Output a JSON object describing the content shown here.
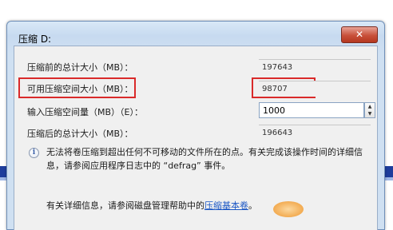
{
  "dialog": {
    "title": "压缩 D:",
    "close_label": "✕"
  },
  "fields": {
    "total_before": {
      "label": "压缩前的总计大小（MB）：",
      "value": "197643"
    },
    "available": {
      "label": "可用压缩空间大小（MB）：",
      "value": "98707"
    },
    "shrink_amount": {
      "label": "输入压缩空间量（MB）（E）：",
      "value": "1000"
    },
    "total_after": {
      "label": "压缩后的总计大小（MB）：",
      "value": "196643"
    }
  },
  "info": {
    "icon": "info-icon",
    "text": "无法将卷压缩到超出任何不可移动的文件所在的点。有关完成该操作时间的详细信息，请参阅应用程序日志中的 “defrag” 事件。"
  },
  "help": {
    "prefix": "有关详细信息，请参阅磁盘管理帮助中的",
    "link": "压缩基本卷",
    "suffix": "。"
  },
  "colors": {
    "highlight": "#d92a2a",
    "link": "#1a56c4",
    "close_button": "#c8503a"
  }
}
